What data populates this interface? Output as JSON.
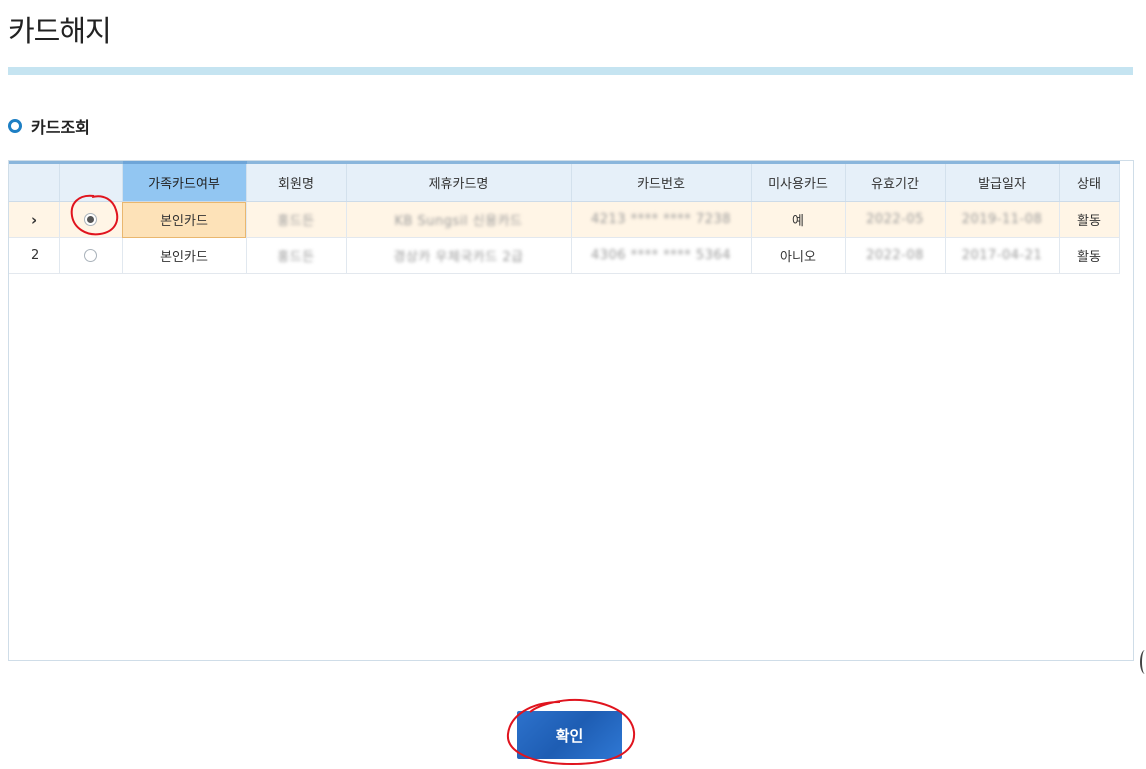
{
  "page": {
    "title": "카드해지"
  },
  "section": {
    "title": "카드조회"
  },
  "grid": {
    "columns": [
      "",
      "",
      "가족카드여부",
      "회원명",
      "제휴카드명",
      "카드번호",
      "미사용카드",
      "유효기간",
      "발급일자",
      "상태"
    ],
    "rows": [
      {
        "num": "",
        "selected": true,
        "family": "본인카드",
        "member": "홍드든",
        "card_name": "KB Sungsil 신용카드",
        "card_no": "4213 **** **** 7238",
        "unused": "예",
        "expiry": "2022-05",
        "issued": "2019-11-08",
        "status": "활동"
      },
      {
        "num": "2",
        "selected": false,
        "family": "본인카드",
        "member": "홍드든",
        "card_name": "경상카 우체국카드 2급",
        "card_no": "4306 **** **** 5364",
        "unused": "아니오",
        "expiry": "2022-08",
        "issued": "2017-04-21",
        "status": "활동"
      }
    ]
  },
  "buttons": {
    "confirm": "확인"
  },
  "icons": {
    "row_pointer": "chevron-right-icon",
    "section_bullet": "circle-bullet-icon"
  },
  "colors": {
    "accent": "#1e5db3",
    "title_bar": "#c5e4f1",
    "sorted_header": "#92c6f2",
    "selected_row": "#fff5e6"
  }
}
